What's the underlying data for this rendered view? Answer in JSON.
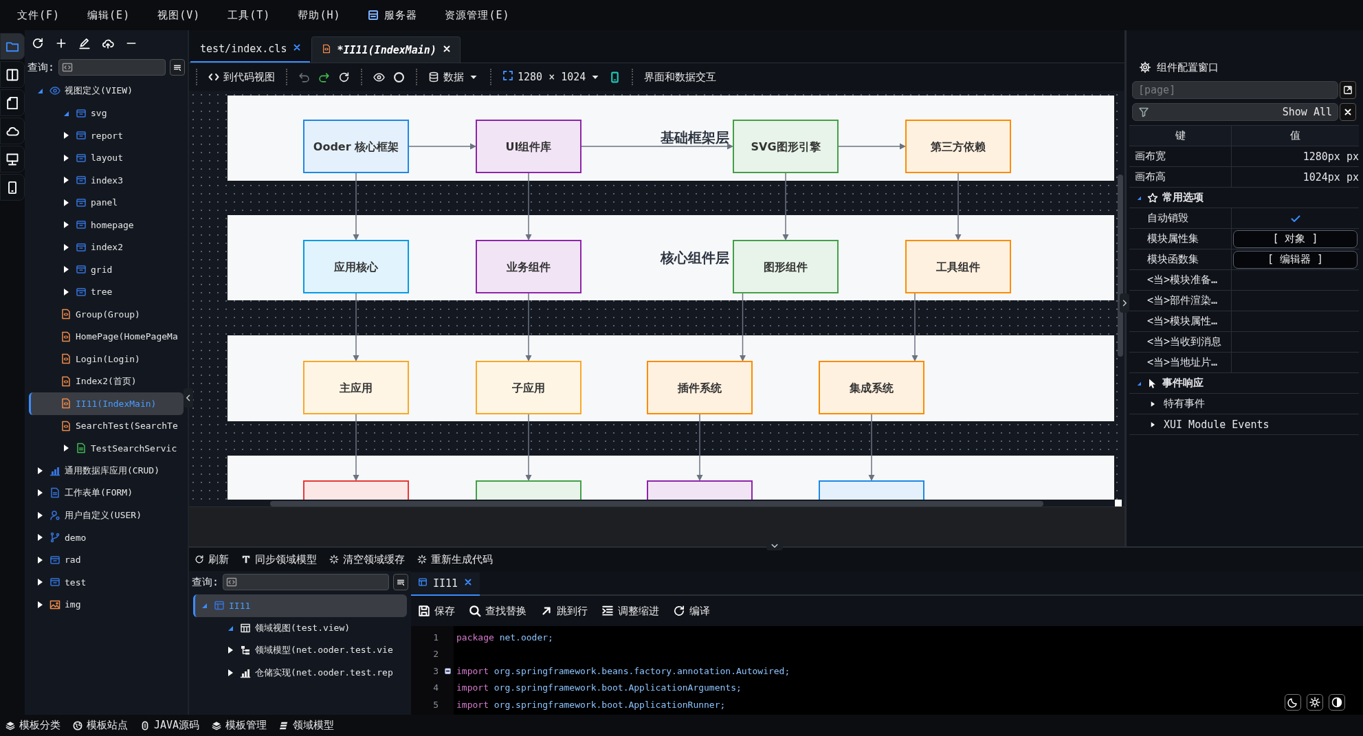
{
  "menu": [
    {
      "label": "文件(F)",
      "kind": "text"
    },
    {
      "label": "编辑(E)",
      "kind": "text"
    },
    {
      "label": "视图(V)",
      "kind": "text"
    },
    {
      "label": "工具(T)",
      "kind": "text"
    },
    {
      "label": "帮助(H)",
      "kind": "text"
    },
    {
      "label": "服务器",
      "kind": "icon"
    },
    {
      "label": "资源管理(E)",
      "kind": "text"
    }
  ],
  "activity_bar": [
    {
      "selected": true
    },
    {
      "selected": false
    },
    {
      "selected": false
    },
    {
      "selected": false
    },
    {
      "selected": false
    },
    {
      "selected": false
    }
  ],
  "explorer": {
    "query_label": "查询:",
    "tree": [
      {
        "label": "视图定义(VIEW)",
        "kind": "view",
        "expanded": true,
        "selected": false,
        "children": [
          {
            "label": "svg",
            "kind": "folder",
            "expanded": true,
            "selected": false
          },
          {
            "label": "report",
            "kind": "folder",
            "expanded": false,
            "selected": false
          },
          {
            "label": "layout",
            "kind": "folder",
            "expanded": false,
            "selected": false
          },
          {
            "label": "index3",
            "kind": "folder",
            "expanded": false,
            "selected": false
          },
          {
            "label": "panel",
            "kind": "folder",
            "expanded": false,
            "selected": false
          },
          {
            "label": "homepage",
            "kind": "folder",
            "expanded": false,
            "selected": false
          },
          {
            "label": "index2",
            "kind": "folder",
            "expanded": false,
            "selected": false
          },
          {
            "label": "grid",
            "kind": "folder",
            "expanded": false,
            "selected": false
          },
          {
            "label": "tree",
            "kind": "folder",
            "expanded": false,
            "selected": false
          },
          {
            "label": "Group(Group)",
            "kind": "page",
            "selected": false
          },
          {
            "label": "HomePage(HomePageMa",
            "kind": "page",
            "selected": false
          },
          {
            "label": "Login(Login)",
            "kind": "page",
            "selected": false
          },
          {
            "label": "Index2(首页)",
            "kind": "page",
            "selected": false
          },
          {
            "label": "II11(IndexMain)",
            "kind": "page",
            "selected": true
          },
          {
            "label": "SearchTest(SearchTe",
            "kind": "page",
            "selected": false
          },
          {
            "label": "TestSearchServic",
            "kind": "file",
            "expanded": false,
            "selected": false
          }
        ]
      },
      {
        "label": "通用数据库应用(CRUD)",
        "kind": "database",
        "expanded": false,
        "selected": false
      },
      {
        "label": "工作表单(FORM)",
        "kind": "form",
        "expanded": false,
        "selected": false
      },
      {
        "label": "用户自定义(USER)",
        "kind": "user",
        "expanded": false,
        "selected": false
      },
      {
        "label": "demo",
        "kind": "branch",
        "expanded": false,
        "selected": false
      },
      {
        "label": "rad",
        "kind": "folder",
        "expanded": false,
        "selected": false
      },
      {
        "label": "test",
        "kind": "folder",
        "expanded": false,
        "selected": false
      },
      {
        "label": "img",
        "kind": "image",
        "expanded": false,
        "selected": false
      }
    ]
  },
  "editor_tabs": [
    {
      "label": "test/index.cls",
      "selected": false
    },
    {
      "label": "*II11(IndexMain)",
      "selected": true
    }
  ],
  "designer_toolbar": {
    "code_view": "到代码视图",
    "undo": {
      "disabled": true
    },
    "redo": {
      "disabled": false
    },
    "data_menu": "数据",
    "canvas_size": "1280 × 1024",
    "mode_label": "界面和数据交互"
  },
  "diagram": {
    "layers": [
      {
        "title": "基础框架层",
        "nodes": [
          {
            "label": "Ooder 核心框架",
            "color": "#1e88e5",
            "arrow_right": true,
            "arrow_down": true
          },
          {
            "label": "UI组件库",
            "color": "#8e24aa",
            "arrow_right": true,
            "arrow_down": true
          },
          {
            "label": "SVG图形引擎",
            "color": "#43a047",
            "arrow_right": true,
            "arrow_down": true
          },
          {
            "label": "第三方依赖",
            "color": "#fb8c00",
            "arrow_down": true
          }
        ]
      },
      {
        "title": "核心组件层",
        "nodes": [
          {
            "label": "应用核心",
            "color": "#039be5",
            "arrow_down": true
          },
          {
            "label": "业务组件",
            "color": "#8e24aa",
            "arrow_down": true
          },
          {
            "label": "图形组件",
            "color": "#43a047",
            "arrow_down": true
          },
          {
            "label": "工具组件",
            "color": "#fb8c00",
            "arrow_down": true
          }
        ]
      },
      {
        "nodes": [
          {
            "label": "主应用",
            "color": "#f9a825",
            "arrow_down": true
          },
          {
            "label": "子应用",
            "color": "#f9a825",
            "arrow_down": true
          },
          {
            "label": "插件系统",
            "color": "#fb8c00",
            "arrow_down": true
          },
          {
            "label": "集成系统",
            "color": "#fb8c00",
            "arrow_down": true
          }
        ]
      },
      {
        "nodes": [
          {
            "color": "#e53935"
          },
          {
            "color": "#43a047"
          },
          {
            "color": "#8e24aa"
          },
          {
            "color": "#1e88e5"
          }
        ]
      }
    ]
  },
  "properties": {
    "title": "组件配置窗口",
    "path": {
      "placeholder": "[page]"
    },
    "filter": {
      "value": "Show All"
    },
    "columns": [
      "键",
      "值"
    ],
    "rows": [
      {
        "kind": "value",
        "key": "画布宽",
        "value": "1280px px"
      },
      {
        "kind": "value",
        "key": "画布高",
        "value": "1024px px"
      },
      {
        "kind": "group",
        "label": "常用选项",
        "expanded": true
      },
      {
        "kind": "check",
        "key": "自动销毁",
        "checked": true
      },
      {
        "kind": "button",
        "key": "模块属性集",
        "button": "[ 对象 ]"
      },
      {
        "kind": "button",
        "key": "模块函数集",
        "button": "[ 编辑器 ]"
      },
      {
        "kind": "event",
        "key": "<当>模块准备…"
      },
      {
        "kind": "event",
        "key": "<当>部件渲染…"
      },
      {
        "kind": "event",
        "key": "<当>模块属性…"
      },
      {
        "kind": "event",
        "key": "<当>当收到消息"
      },
      {
        "kind": "event",
        "key": "<当>当地址片…"
      },
      {
        "kind": "group",
        "label": "事件响应",
        "expanded": true
      },
      {
        "kind": "subgroup",
        "label": "特有事件",
        "expanded": false
      },
      {
        "kind": "subgroup",
        "label": "XUI Module Events",
        "expanded": false
      }
    ]
  },
  "domain_toolbar": [
    "刷新",
    "同步领域模型",
    "清空领域缓存",
    "重新生成代码"
  ],
  "domain": {
    "query_label": "查询:",
    "tree": [
      {
        "label": "II11",
        "kind": "module",
        "expanded": true,
        "selected": true,
        "children": [
          {
            "label": "领域视图(test.view)",
            "kind": "table",
            "expanded": true,
            "selected": false
          },
          {
            "label": "领域模型(net.ooder.test.vie",
            "kind": "hierarchy",
            "expanded": false,
            "selected": false
          },
          {
            "label": "仓储实现(net.ooder.test.rep",
            "kind": "storage",
            "expanded": false,
            "selected": false
          }
        ]
      }
    ]
  },
  "code_tabs": [
    {
      "label": "II11",
      "selected": true
    }
  ],
  "code_toolbar": [
    "保存",
    "查找替换",
    "跳到行",
    "调整缩进",
    "编译"
  ],
  "code": [
    {
      "number": "1",
      "keyword": "package",
      "text": "net.ooder;"
    },
    {
      "number": "2"
    },
    {
      "number": "3",
      "keyword": "import",
      "text": "org.springframework.beans.factory.annotation.Autowired;",
      "fold": true
    },
    {
      "number": "4",
      "keyword": "import",
      "text": "org.springframework.boot.ApplicationArguments;"
    },
    {
      "number": "5",
      "keyword": "import",
      "text": "org.springframework.boot.ApplicationRunner;"
    }
  ],
  "status_bar": [
    "模板分类",
    "模板站点",
    "JAVA源码",
    "模板管理",
    "领域模型"
  ]
}
